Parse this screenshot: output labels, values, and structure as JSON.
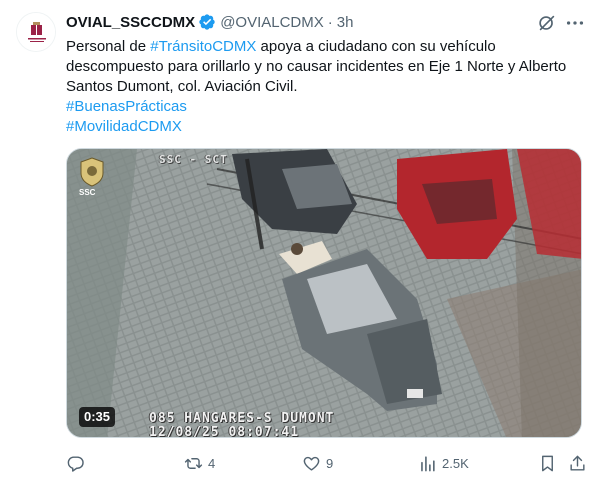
{
  "tweet": {
    "display_name": "OVIAL_SSCCDMX",
    "handle": "@OVIALCDMX",
    "separator": "·",
    "time": "3h",
    "text": {
      "line1_prefix": "Personal de ",
      "line1_hashtag": "#TránsitoCDMX",
      "line1_suffix": " apoya a ciudadano con su vehículo",
      "line2": "descompuesto para orillarlo y no causar incidentes en Eje 1 Norte y  Alberto",
      "line3": "Santos Dumont, col. Aviación Civil.",
      "hashtag1": "#BuenasPrácticas",
      "hashtag2": "#MovilidadCDMX"
    }
  },
  "media": {
    "duration": "0:35",
    "badge_label": "SSC",
    "osd_top": "SSC - SCT",
    "osd_location": "085 HANGARES-S DUMONT",
    "osd_datetime": "12/08/25 08:07:41"
  },
  "actions": {
    "reply_count": "",
    "retweet_count": "4",
    "like_count": "9",
    "views_count": "2.5K"
  },
  "colors": {
    "link": "#1d9bf0",
    "secondary_text": "#536471",
    "verified": "#1d9bf0"
  }
}
